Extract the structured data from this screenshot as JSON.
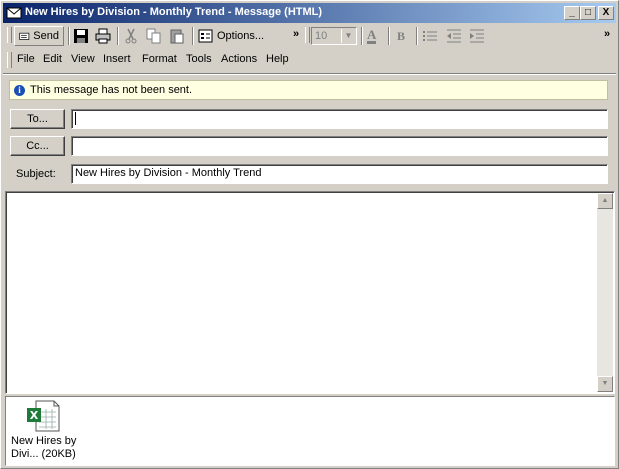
{
  "window": {
    "title": "New Hires by Division - Monthly Trend - Message (HTML)",
    "controls": {
      "minimize": "_",
      "maximize": "□",
      "close": "X"
    }
  },
  "toolbar": {
    "send": "Send",
    "options": "Options...",
    "font_size": "10",
    "bold": "B",
    "font_color": "A",
    "more": "»"
  },
  "menu": [
    "File",
    "Edit",
    "View",
    "Insert",
    "Format",
    "Tools",
    "Actions",
    "Help"
  ],
  "info_bar": {
    "text": "This message has not been sent."
  },
  "header": {
    "to_button": "To...",
    "cc_button": "Cc...",
    "to_value": "",
    "cc_value": "",
    "subject_label": "Subject:",
    "subject_value": "New Hires by Division - Monthly Trend"
  },
  "attachment": {
    "name": "New Hires by Divi... (20KB)",
    "icon": "excel-file-icon"
  },
  "colors": {
    "titlebar_start": "#0a246a",
    "titlebar_end": "#a6caf0",
    "info_bg": "#ffffe1"
  }
}
